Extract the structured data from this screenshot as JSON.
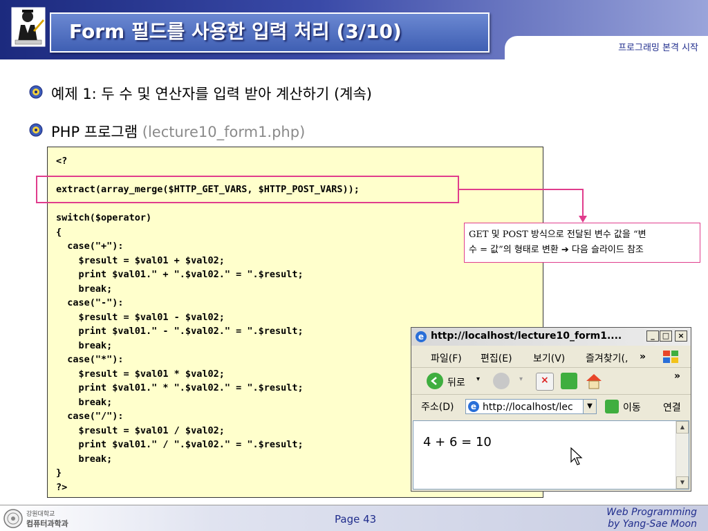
{
  "header": {
    "title": "Form 필드를 사용한 입력 처리 (3/10)",
    "subtitle": "프로그래밍 본격 시작"
  },
  "bullets": [
    {
      "text": "예제 1: 두 수 및 연산자를 입력 받아 계산하기 (계속)",
      "gray": ""
    },
    {
      "text": "PHP 프로그램 ",
      "gray": "(lecture10_form1.php)"
    }
  ],
  "code_lines": [
    "<?",
    "",
    "extract(array_merge($HTTP_GET_VARS, $HTTP_POST_VARS));",
    "",
    "switch($operator)",
    "{",
    "  case(\"+\"):",
    "    $result = $val01 + $val02;",
    "    print $val01.\" + \".$val02.\" = \".$result;",
    "    break;",
    "  case(\"-\"):",
    "    $result = $val01 - $val02;",
    "    print $val01.\" - \".$val02.\" = \".$result;",
    "    break;",
    "  case(\"*\"):",
    "    $result = $val01 * $val02;",
    "    print $val01.\" * \".$val02.\" = \".$result;",
    "    break;",
    "  case(\"/\"):",
    "    $result = $val01 / $val02;",
    "    print $val01.\" / \".$val02.\" = \".$result;",
    "    break;",
    "}",
    "?>"
  ],
  "note": {
    "line1": "GET 및 POST 방식으로 전달된 변수 값을 “변",
    "line2_a": "수 = 값”의 형태로 변환 ",
    "arrow": "➔",
    "line2_b": " 다음 슬라이드 참조"
  },
  "browser": {
    "title": "http://localhost/lecture10_form1....",
    "menu": [
      "파일(F)",
      "편집(E)",
      "보기(V)",
      "즐겨찾기(,"
    ],
    "more": "»",
    "back_label": "뒤로",
    "address_label": "주소(D)",
    "address_value": "http://localhost/lec",
    "go_label": "이동",
    "links_label": "연결",
    "content": "4 + 6 = 10"
  },
  "footer": {
    "page": "Page 43",
    "credit_line1": "Web Programming",
    "credit_line2": "by Yang-Sae Moon",
    "logo_text1": "강원대학교",
    "logo_text2": "컴퓨터과학과"
  },
  "colors": {
    "header_blue": "#1c2a7e",
    "title_box": "#3f5fb3",
    "highlight_pink": "#e03c8c",
    "code_bg": "#ffffcc",
    "footer_text": "#1f2c8c"
  }
}
